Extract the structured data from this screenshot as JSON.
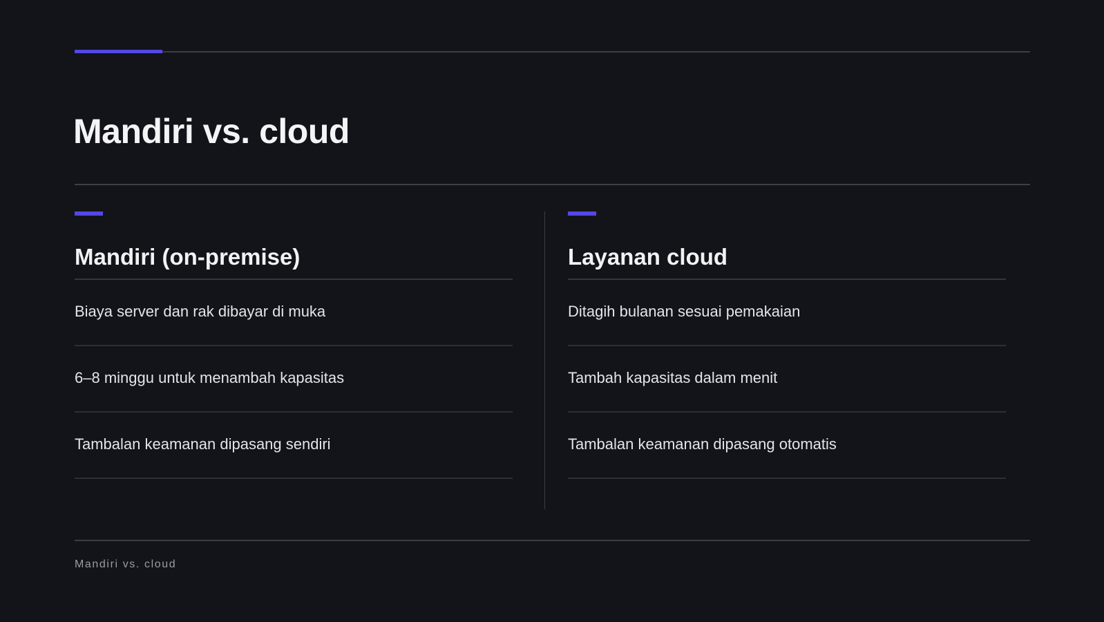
{
  "slide": {
    "title": "Mandiri vs. cloud",
    "footer": "Mandiri vs. cloud",
    "accent_color": "#5447e6",
    "background_color": "#131419"
  },
  "columns": [
    {
      "heading": "Mandiri (on-premise)",
      "items": [
        "Biaya server dan rak dibayar di muka",
        "6–8 minggu untuk menambah kapasitas",
        "Tambalan keamanan dipasang sendiri"
      ]
    },
    {
      "heading": "Layanan cloud",
      "items": [
        "Ditagih bulanan sesuai pemakaian",
        "Tambah kapasitas dalam menit",
        "Tambalan keamanan dipasang otomatis"
      ]
    }
  ]
}
